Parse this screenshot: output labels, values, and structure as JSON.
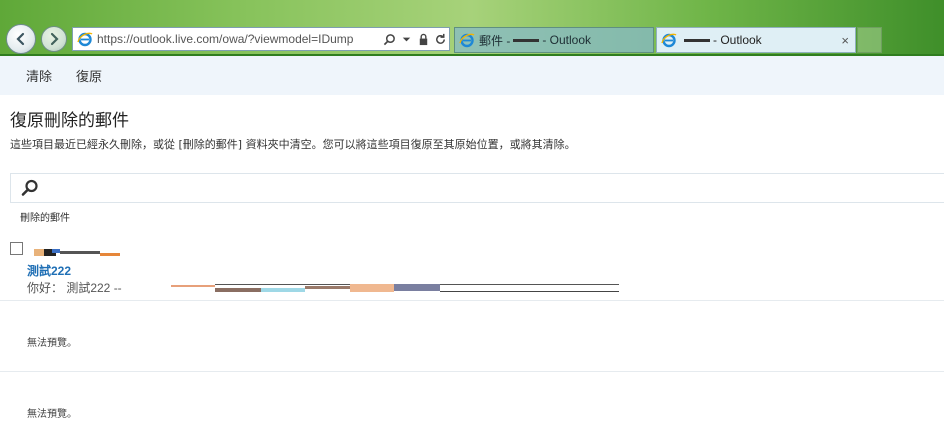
{
  "browser": {
    "url": "https://outlook.live.com/owa/?viewmodel=IDump",
    "tabs": [
      {
        "label_prefix": "郵件 - ",
        "label_suffix": " - Outlook",
        "active": false
      },
      {
        "label_prefix": "",
        "label_suffix": " - Outlook",
        "active": true,
        "close": "×"
      }
    ]
  },
  "toolbar": {
    "clear_label": "清除",
    "restore_label": "復原"
  },
  "page": {
    "title": "復原刪除的郵件",
    "description": "這些項目最近已經永久刪除，或從 [刪除的郵件] 資料夾中清空。您可以將這些項目復原至其原始位置，或將其清除。"
  },
  "search": {
    "placeholder": ""
  },
  "folder": {
    "label": "刪除的郵件"
  },
  "messages": [
    {
      "subject": "測試222",
      "preview": "你好： 測試222 --"
    }
  ],
  "previews": {
    "unavailable_1": "無法預覽。",
    "unavailable_2": "無法預覽。"
  },
  "colors": {
    "accent": "#1f6fb5",
    "command_bar": "#eff5fb",
    "chrome_green": "#6fb548"
  },
  "icons": [
    "back-arrow-icon",
    "forward-arrow-icon",
    "ie-icon",
    "search-icon",
    "lock-icon",
    "refresh-icon",
    "dropdown-icon",
    "close-icon",
    "checkbox-icon"
  ]
}
